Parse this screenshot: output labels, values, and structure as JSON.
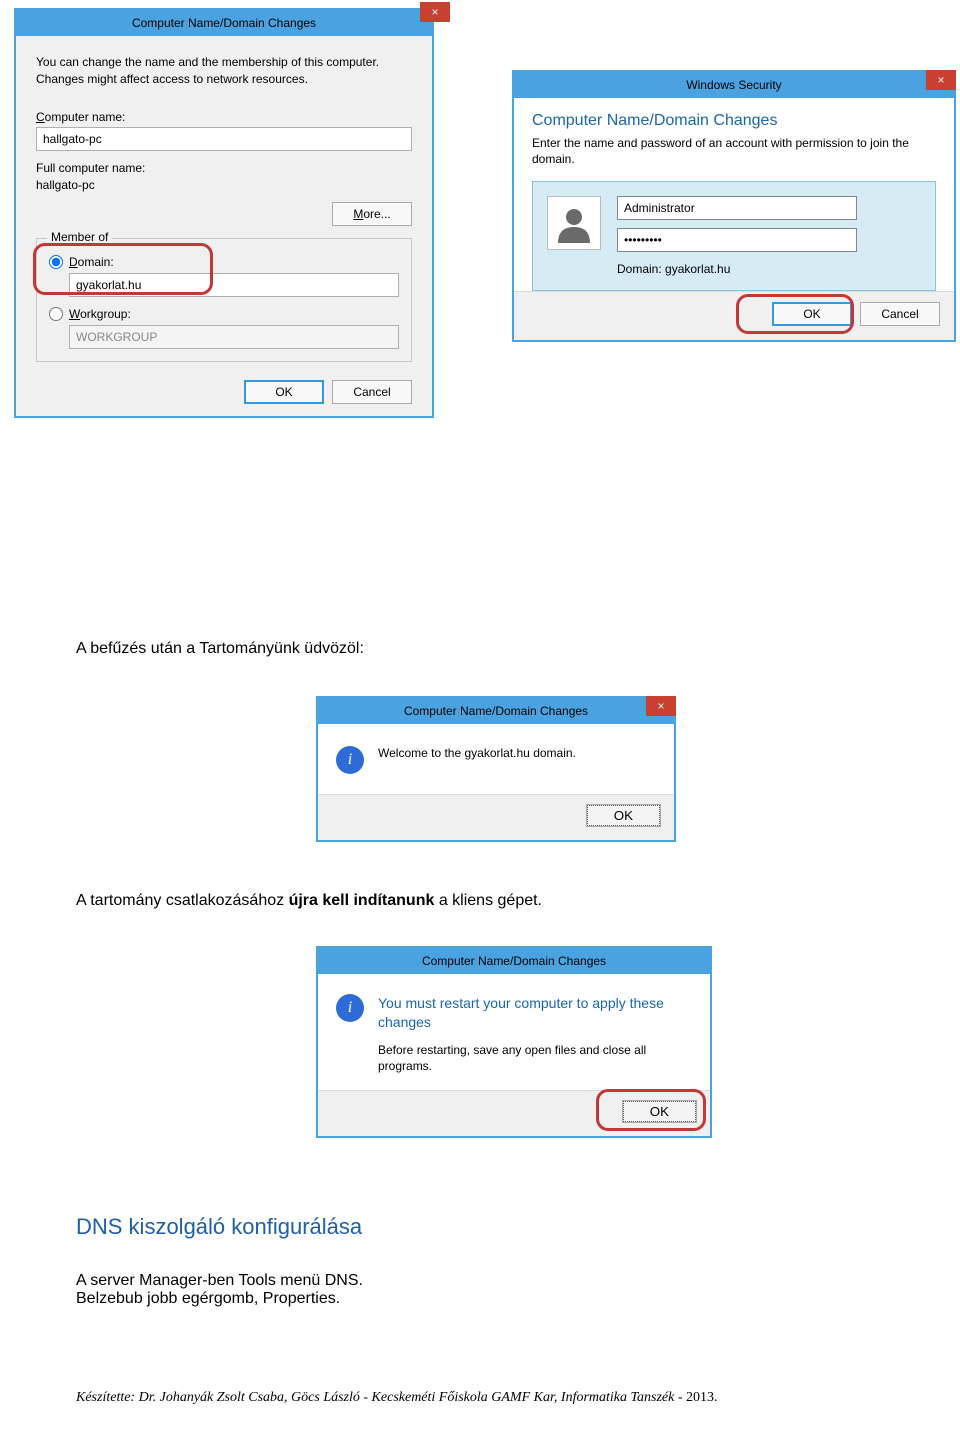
{
  "nameDomainDialog": {
    "title": "Computer Name/Domain Changes",
    "close": "×",
    "description": "You can change the name and the membership of this computer. Changes might affect access to network resources.",
    "computerNameLabel": "Computer name:",
    "computerNameValue": "hallgato-pc",
    "fullNameLabel": "Full computer name:",
    "fullNameValue": "hallgato-pc",
    "moreButton": "More...",
    "memberOf": "Member of",
    "domainLabel": "Domain:",
    "domainValue": "gyakorlat.hu",
    "workgroupLabel": "Workgroup:",
    "workgroupValue": "WORKGROUP",
    "ok": "OK",
    "cancel": "Cancel"
  },
  "securityDialog": {
    "title": "Windows Security",
    "close": "×",
    "heading": "Computer Name/Domain Changes",
    "description": "Enter the name and password of an account with permission to join the domain.",
    "userValue": "Administrator",
    "passValue": "•••••••••",
    "domainLine": "Domain: gyakorlat.hu",
    "ok": "OK",
    "cancel": "Cancel"
  },
  "text1": "A befűzés után a Tartományünk üdvözöl:",
  "welcomeDialog": {
    "title": "Computer Name/Domain Changes",
    "close": "×",
    "message": "Welcome to the gyakorlat.hu domain.",
    "ok": "OK"
  },
  "text2_pre": "A tartomány csatlakozásához ",
  "text2_bold": "újra kell indítanunk",
  "text2_post": " a kliens gépet.",
  "restartDialog": {
    "title": "Computer Name/Domain Changes",
    "main": "You must restart your computer to apply these changes",
    "sub": "Before restarting, save any open files and close all programs.",
    "ok": "OK"
  },
  "dnsHeading": "DNS kiszolgáló konfigurálása",
  "text3a": "A server Manager-ben Tools menü DNS.",
  "text3b": "Belzebub jobb egérgomb, Properties.",
  "footer": "Készítette: Dr. Johanyák Zsolt Csaba, Göcs László - Kecskeméti Főiskola GAMF Kar, Informatika Tanszék",
  "footer_year": " - 2013."
}
